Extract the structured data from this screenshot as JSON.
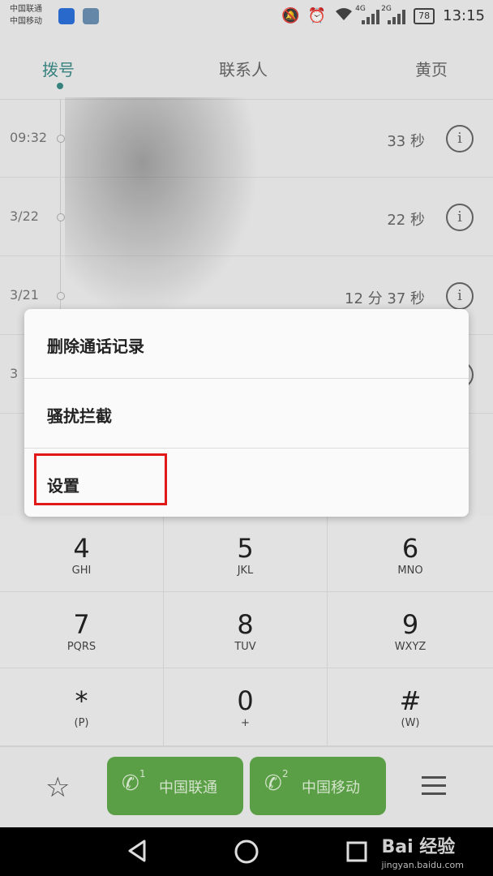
{
  "status": {
    "carrier1": "中国联通",
    "carrier2": "中国移动",
    "net1": "4G",
    "net2": "2G",
    "battery": "78",
    "time": "13:15"
  },
  "tabs": [
    "拨号",
    "联系人",
    "黄页"
  ],
  "logs": [
    {
      "time": "09:32",
      "duration": "33 秒"
    },
    {
      "time": "3/22",
      "duration": "22 秒"
    },
    {
      "time": "3/21",
      "duration": "12 分 37 秒"
    },
    {
      "time": "3",
      "duration": ""
    }
  ],
  "info_glyph": "i",
  "menu": {
    "items": [
      "删除通话记录",
      "骚扰拦截",
      "设置"
    ]
  },
  "keypad": [
    {
      "num": "4",
      "letters": "GHI"
    },
    {
      "num": "5",
      "letters": "JKL"
    },
    {
      "num": "6",
      "letters": "MNO"
    },
    {
      "num": "7",
      "letters": "PQRS"
    },
    {
      "num": "8",
      "letters": "TUV"
    },
    {
      "num": "9",
      "letters": "WXYZ"
    },
    {
      "num": "*",
      "letters": "(P)"
    },
    {
      "num": "0",
      "letters": "+"
    },
    {
      "num": "#",
      "letters": "(W)"
    }
  ],
  "call_buttons": [
    {
      "sim": "1",
      "label": "中国联通"
    },
    {
      "sim": "2",
      "label": "中国移动"
    }
  ],
  "watermark": {
    "brand": "Bai 经验",
    "url": "jingyan.baidu.com"
  }
}
